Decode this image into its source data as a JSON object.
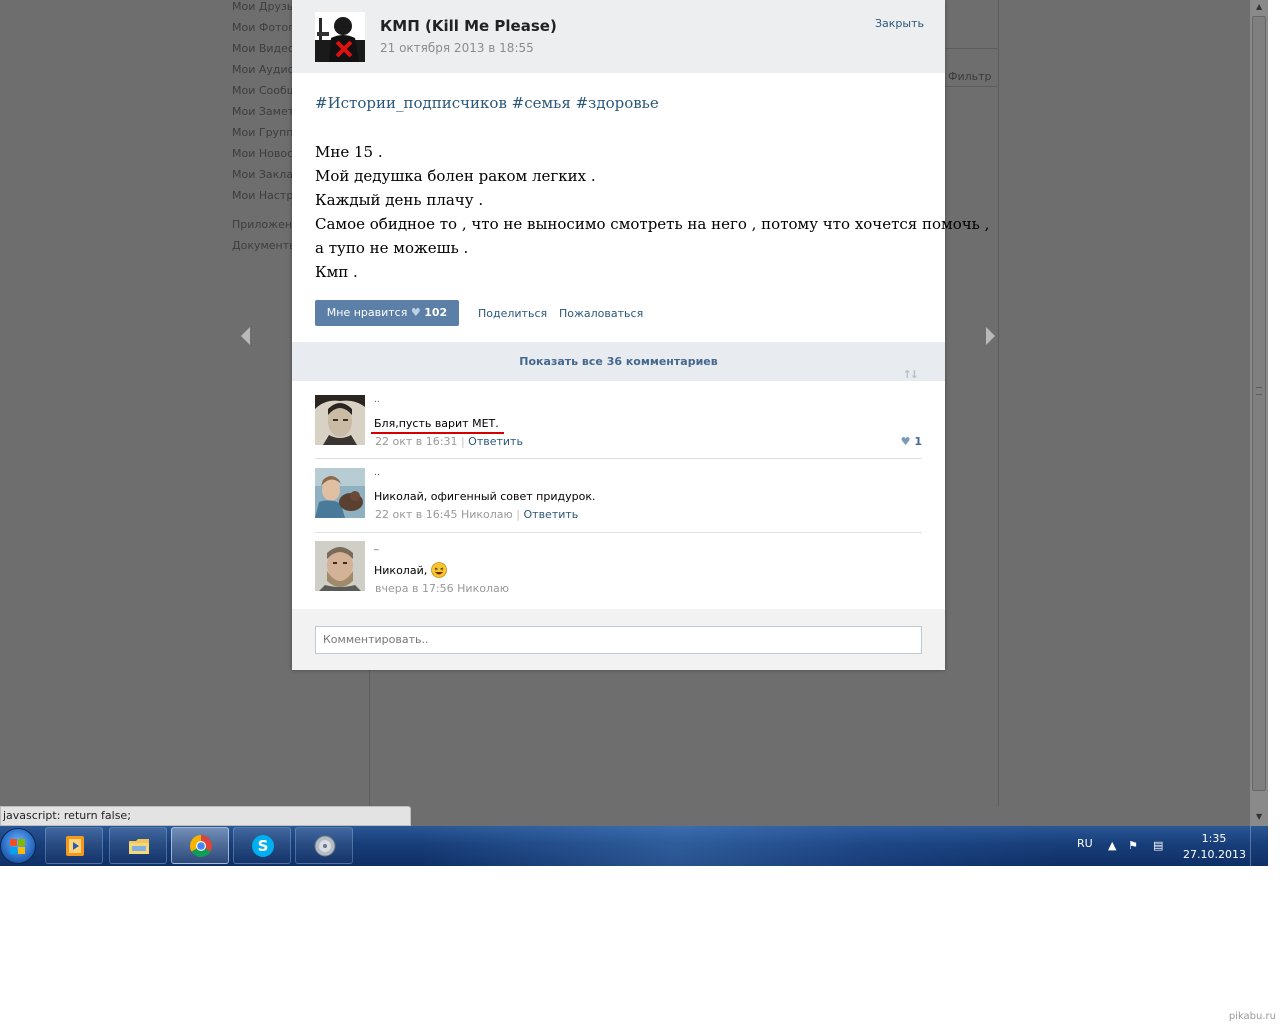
{
  "left_menu": {
    "items": [
      "Мои Друзья",
      "Мои Фотографии",
      "Мои Видеозаписи",
      "Мои Аудиозаписи",
      "Мои Сообщения",
      "Мои Заметки",
      "Мои Группы",
      "Мои Новости",
      "Мои Закладки",
      "Мои Настройки"
    ],
    "extra": [
      "Приложения",
      "Документы"
    ]
  },
  "page": {
    "filter_label": "Фильтр"
  },
  "post": {
    "author": "КМП (Kill Me Please)",
    "date": "21 октября 2013 в 18:55",
    "close_label": "Закрыть",
    "tags": "#Истории_подписчиков #семья #здоровье",
    "text_lines": [
      "Мне 15 .",
      "Мой дедушка болен раком легких .",
      "Каждый день плачу .",
      "Самое обидное то , что не выносимо смотреть на него , потому что хочется помочь ,",
      "а тупо не можешь .",
      "Кмп ."
    ],
    "like_label": "Мне нравится",
    "like_count": "102",
    "share_label": "Поделиться",
    "report_label": "Пожаловаться",
    "show_all_comments": "Показать все 36 комментариев"
  },
  "comments": [
    {
      "name": "..",
      "text": "Бля,пусть варит МЕТ.",
      "time": "22 окт в 16:31",
      "reply_to": "",
      "reply_label": "Ответить",
      "likes": "1",
      "highlighted": true
    },
    {
      "name": "..",
      "text": "Николай, офигенный совет придурок.",
      "time": "22 окт в 16:45",
      "reply_to": "Николаю",
      "reply_label": "Ответить",
      "likes": ""
    },
    {
      "name": "_",
      "text": "Николай,",
      "emoji": "laughing-emoji",
      "time": "вчера в 17:56",
      "reply_to": "Николаю",
      "reply_label": "",
      "likes": ""
    }
  ],
  "comment_input": {
    "placeholder": "Комментировать.."
  },
  "status_bar": {
    "text": "javascript: return false;"
  },
  "taskbar": {
    "apps": [
      "media-player-icon",
      "file-explorer-icon",
      "chrome-icon",
      "skype-icon",
      "audio-app-icon"
    ],
    "active_app": "chrome-icon",
    "language": "RU",
    "time": "1:35",
    "date": "27.10.2013"
  },
  "watermark": "pikabu.ru",
  "colors": {
    "link": "#2b587a",
    "like_button": "#5b7fa6",
    "highlight_underline": "#d40000",
    "taskbar": "#183e79"
  }
}
